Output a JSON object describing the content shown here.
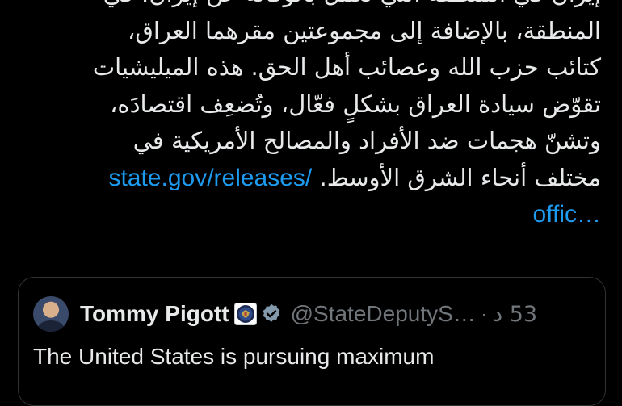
{
  "tweet": {
    "lines": [
      "إيران في المنطقة التي تعمل بالوكالة عن إيران، في",
      "المنطقة، بالإضافة إلى مجموعتين مقرهما العراق،",
      "كتائب حزب الله وعصائب أهل الحق. هذه الميليشيات",
      "تقوّض سيادة العراق بشكلٍ فعّال، وتُضعِف اقتصادَه،",
      "وتشنّ هجمات ضد الأفراد والمصالح الأمريكية في"
    ],
    "last_line_text": "مختلف أنحاء الشرق الأوسط.",
    "link_part1": "state.gov/releases/",
    "link_part2": "offic…"
  },
  "quote": {
    "author_name": "Tommy Pigott",
    "handle": "@StateDeputyS…",
    "separator": "·",
    "time_ago": "53 د",
    "text": "The United States is pursuing maximum"
  },
  "icons": {
    "seal": "state-department-seal-icon",
    "verified": "verified-check-icon"
  },
  "colors": {
    "background": "#000000",
    "text": "#e7e9ea",
    "link": "#1d9bf0",
    "muted": "#71767b",
    "border": "#2f3336"
  }
}
